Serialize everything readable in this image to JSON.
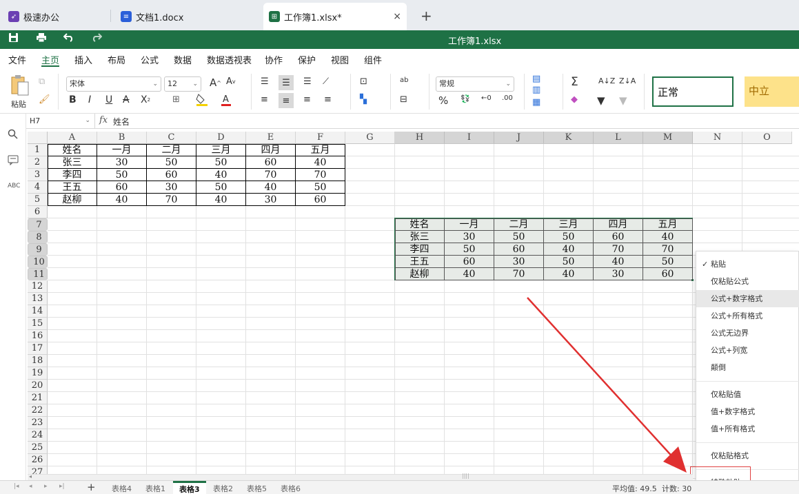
{
  "app_tabs": [
    {
      "label": "极速办公",
      "icon": "rocket-icon",
      "color": "#6b3fb3"
    },
    {
      "label": "文档1.docx",
      "icon": "word-doc-icon",
      "color": "#2b5fd9"
    },
    {
      "label": "工作簿1.xlsx*",
      "icon": "spreadsheet-icon",
      "color": "#1e7145"
    }
  ],
  "close_glyph": "×",
  "new_tab_glyph": "+",
  "window_title": "工作簿1.xlsx",
  "menu": [
    "文件",
    "主页",
    "插入",
    "布局",
    "公式",
    "数据",
    "数据透视表",
    "协作",
    "保护",
    "视图",
    "组件"
  ],
  "ribbon": {
    "paste_label": "粘贴",
    "font_name": "宋体",
    "font_size": "12",
    "number_format": "常规",
    "style_normal": "正常",
    "style_neutral": "中立",
    "bold": "B",
    "italic": "I",
    "underline": "U",
    "strike": "A",
    "subscript": "X",
    "grow_font": "A",
    "shrink_font": "A",
    "percent": "%",
    "sum": "Σ"
  },
  "formula_bar": {
    "name_box": "H7",
    "fx": "fx",
    "value": "姓名"
  },
  "columns": [
    "A",
    "B",
    "C",
    "D",
    "E",
    "F",
    "G",
    "H",
    "I",
    "J",
    "K",
    "L",
    "M",
    "N",
    "O"
  ],
  "selected_columns": [
    "H",
    "I",
    "J",
    "K",
    "L",
    "M"
  ],
  "rows": [
    "1",
    "2",
    "3",
    "4",
    "5",
    "6",
    "7",
    "8",
    "9",
    "10",
    "11",
    "12",
    "13",
    "14",
    "15",
    "16",
    "17",
    "18",
    "19",
    "20",
    "21",
    "22",
    "23",
    "24",
    "25",
    "26",
    "27"
  ],
  "selected_rows": [
    "7",
    "8",
    "9",
    "10",
    "11"
  ],
  "table_source": {
    "header": [
      "姓名",
      "一月",
      "二月",
      "三月",
      "四月",
      "五月"
    ],
    "rows": [
      [
        "张三",
        "30",
        "50",
        "50",
        "60",
        "40"
      ],
      [
        "李四",
        "50",
        "60",
        "40",
        "70",
        "70"
      ],
      [
        "王五",
        "60",
        "30",
        "50",
        "40",
        "50"
      ],
      [
        "赵柳",
        "40",
        "70",
        "40",
        "30",
        "60"
      ]
    ]
  },
  "table_pasted": {
    "header": [
      "姓名",
      "一月",
      "二月",
      "三月",
      "四月",
      "五月"
    ],
    "rows": [
      [
        "张三",
        "30",
        "50",
        "50",
        "60",
        "40"
      ],
      [
        "李四",
        "50",
        "60",
        "40",
        "70",
        "70"
      ],
      [
        "王五",
        "60",
        "30",
        "50",
        "40",
        "50"
      ],
      [
        "赵柳",
        "40",
        "70",
        "40",
        "30",
        "60"
      ]
    ]
  },
  "paste_menu": {
    "check_glyph": "✓",
    "group1": [
      "粘贴",
      "仅粘贴公式",
      "公式+数字格式",
      "公式+所有格式",
      "公式无边界",
      "公式+列宽",
      "颠倒"
    ],
    "group2": [
      "仅粘贴值",
      "值+数字格式",
      "值+所有格式"
    ],
    "group3": [
      "仅粘贴格式"
    ],
    "special": "特殊粘贴",
    "highlighted": "公式+数字格式"
  },
  "sheet_tabs": [
    "表格4",
    "表格1",
    "表格3",
    "表格2",
    "表格5",
    "表格6"
  ],
  "active_sheet": "表格3",
  "status": {
    "average": "平均值: 49.5",
    "count": "计数: 30"
  },
  "colors": {
    "brand_green": "#1e7145",
    "annotation_red": "#e04040",
    "neutral_style": "#fde28a"
  }
}
